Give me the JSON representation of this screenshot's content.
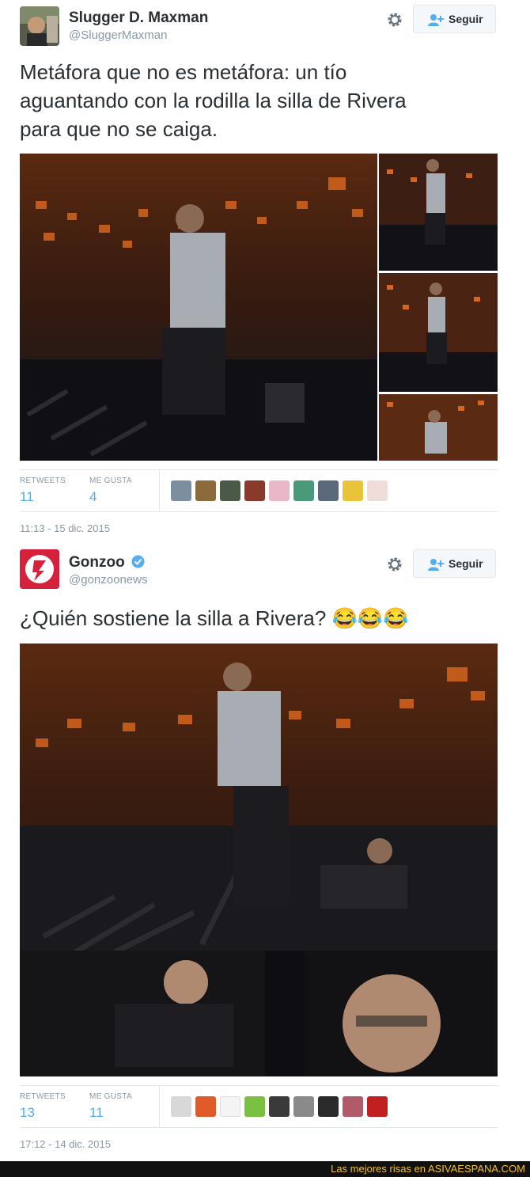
{
  "tweets": [
    {
      "name": "Slugger D. Maxman",
      "handle": "@SluggerMaxman",
      "follow_label": "Seguir",
      "text_lines": [
        "Metáfora que no es metáfora: un tío",
        "aguantando con la rodilla la silla de Rivera",
        "para que no se caiga."
      ],
      "stats": {
        "retweets_label": "RETWEETS",
        "retweets": "11",
        "likes_label": "ME GUSTA",
        "likes": "4"
      },
      "timestamp": "11:13 - 15 dic. 2015"
    },
    {
      "name": "Gonzoo",
      "verified": true,
      "handle": "@gonzoonews",
      "follow_label": "Seguir",
      "text": "¿Quién sostiene la silla a Rivera? 😂😂😂",
      "stats": {
        "retweets_label": "RETWEETS",
        "retweets": "13",
        "likes_label": "ME GUSTA",
        "likes": "11"
      },
      "timestamp": "17:12 - 14 dic. 2015"
    }
  ],
  "footer": {
    "prefix": "Las mejores risas en ",
    "site": "ASIVAESPANA.COM"
  },
  "colors": {
    "link": "#55acee",
    "muted": "#8899a6",
    "border": "#e1e8ed",
    "footer_bg": "#111111",
    "footer_text": "#f4c21e",
    "gonzoo_brand": "#d6213d"
  }
}
